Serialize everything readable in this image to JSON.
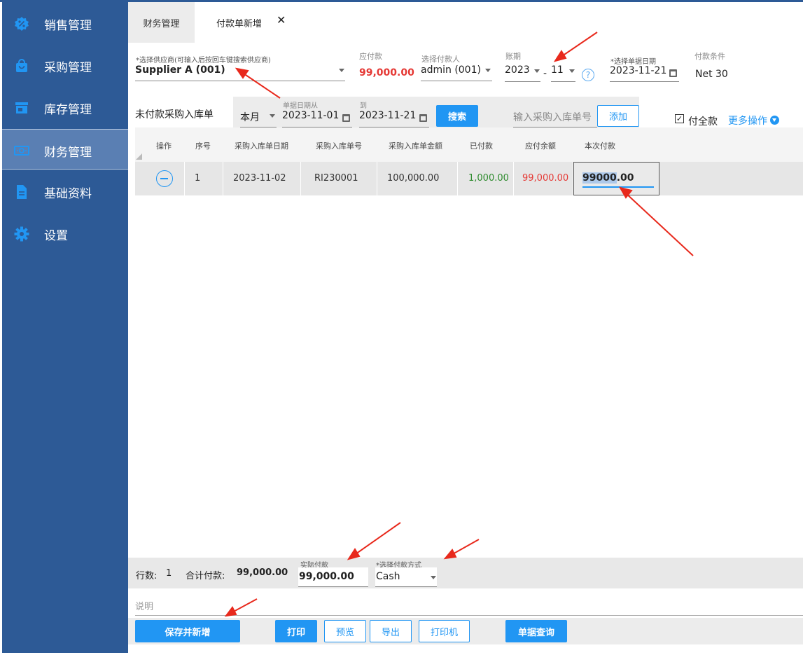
{
  "sidebar": {
    "items": [
      {
        "label": "销售管理",
        "icon": "percent-badge-icon"
      },
      {
        "label": "采购管理",
        "icon": "shopping-bag-icon"
      },
      {
        "label": "库存管理",
        "icon": "store-icon"
      },
      {
        "label": "财务管理",
        "icon": "money-icon",
        "active": true
      },
      {
        "label": "基础资料",
        "icon": "document-icon"
      },
      {
        "label": "设置",
        "icon": "gear-icon"
      }
    ]
  },
  "tabs": {
    "parent": "财务管理",
    "current": "付款单新增",
    "close": "✕"
  },
  "form": {
    "supplier_label": "*选择供应商(可输入后按回车键搜索供应商)",
    "supplier_value": "Supplier A (001)",
    "payable_label": "应付款",
    "payable_value": "99,000.00",
    "payer_label": "选择付款人",
    "payer_value": "admin (001)",
    "period_label": "账期",
    "period_year": "2023",
    "period_sep": "-",
    "period_month": "11",
    "help": "?",
    "date_label": "*选择单据日期",
    "date_value": "2023-11-21",
    "terms_label": "付款条件",
    "terms_value": "Net 30"
  },
  "filter": {
    "section_title": "未付款采购入库单",
    "range_value": "本月",
    "from_label": "单据日期从",
    "from_value": "2023-11-01",
    "to_label": "到",
    "to_value": "2023-11-21",
    "search_button": "搜索",
    "receipt_placeholder": "输入采购入库单号",
    "add_button": "添加",
    "pay_full_label": "付全款",
    "pay_full_checked": true,
    "more_actions": "更多操作"
  },
  "table": {
    "headers": [
      "操作",
      "序号",
      "采购入库单日期",
      "采购入库单号",
      "采购入库单金额",
      "已付款",
      "应付余额",
      "本次付款"
    ],
    "rows": [
      {
        "index": "1",
        "date": "2023-11-02",
        "receipt_no": "RI230001",
        "amount": "100,000.00",
        "paid": "1,000.00",
        "balance": "99,000.00",
        "pay_now_selected": "99000",
        "pay_now_rest": ".00"
      }
    ],
    "colors": {
      "paid": "#2e8b2e",
      "balance": "#e53935"
    }
  },
  "footer": {
    "rows_label": "行数:",
    "rows_value": "1",
    "total_label": "合计付款:",
    "total_value": "99,000.00",
    "actual_label": "实际付款",
    "actual_value": "99,000.00",
    "method_label": "*选择付款方式",
    "method_value": "Cash",
    "note_placeholder": "说明"
  },
  "actions": {
    "save_new": "保存并新增",
    "print": "打印",
    "preview": "预览",
    "export": "导出",
    "printer": "打印机",
    "query": "单据查询"
  },
  "colors": {
    "sidebar": "#2d5a96",
    "accent": "#2196f3",
    "negative": "#e53935",
    "annotation_arrow": "#e8291c"
  }
}
